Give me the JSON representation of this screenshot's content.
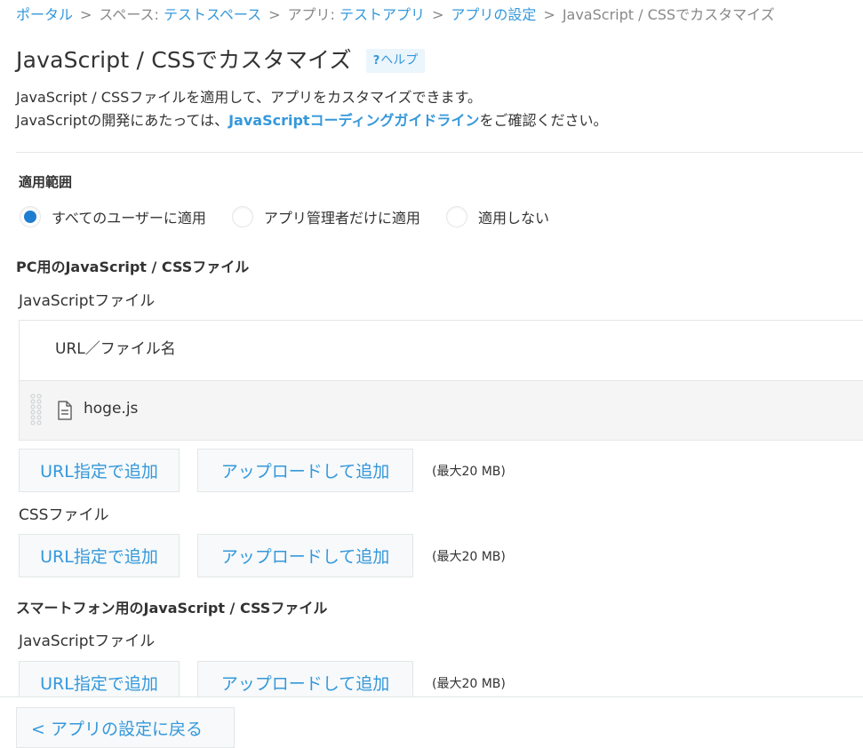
{
  "breadcrumb": {
    "portal": "ポータル",
    "space_prefix": "スペース: ",
    "space_name": "テストスペース",
    "app_prefix": "アプリ: ",
    "app_name": "テストアプリ",
    "app_settings": "アプリの設定",
    "current": "JavaScript / CSSでカスタマイズ",
    "separator": ">"
  },
  "page": {
    "title": "JavaScript / CSSでカスタマイズ",
    "help_label": "ヘルプ",
    "help_mark": "?",
    "description_line1": "JavaScript / CSSファイルを適用して、アプリをカスタマイズできます。",
    "description_line2_before": "JavaScriptの開発にあたっては、",
    "description_link": "JavaScriptコーディングガイドライン",
    "description_line2_after": "をご確認ください。"
  },
  "scope": {
    "label": "適用範囲",
    "options": [
      {
        "label": "すべてのユーザーに適用",
        "selected": true
      },
      {
        "label": "アプリ管理者だけに適用",
        "selected": false
      },
      {
        "label": "適用しない",
        "selected": false
      }
    ]
  },
  "pc": {
    "heading": "PC用のJavaScript / CSSファイル",
    "js_label": "JavaScriptファイル",
    "table_header": "URL／ファイル名",
    "files": [
      {
        "name": "hoge.js"
      }
    ],
    "css_label": "CSSファイル"
  },
  "mobile": {
    "heading": "スマートフォン用のJavaScript / CSSファイル",
    "js_label": "JavaScriptファイル"
  },
  "buttons": {
    "add_url": "URL指定で追加",
    "add_upload": "アップロードして追加",
    "max_size": "(最大20 MB)",
    "back": "< アプリの設定に戻る"
  },
  "colors": {
    "link": "#3498db",
    "radio_selected": "#1f7ed0",
    "border": "#e3e7e8",
    "row_bg": "#f5f5f5"
  },
  "icons": [
    "drag-handle-icon",
    "file-icon"
  ]
}
